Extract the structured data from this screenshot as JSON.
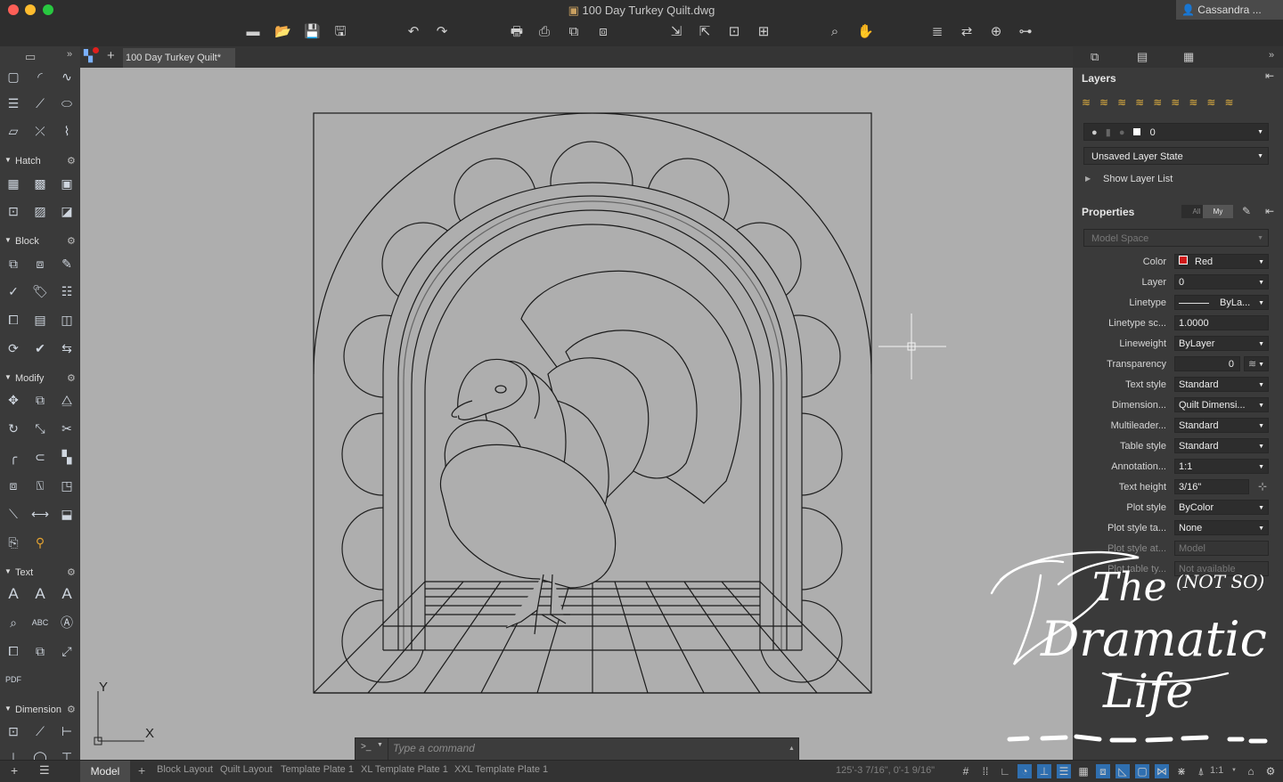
{
  "window": {
    "title": "100 Day Turkey Quilt.dwg",
    "user": "Cassandra ..."
  },
  "tabs": {
    "document": "100 Day Turkey Quilt*"
  },
  "left_panel": {
    "sections": [
      "Hatch",
      "Block",
      "Modify",
      "Text",
      "Dimension"
    ]
  },
  "canvas": {
    "ucs_x": "X",
    "ucs_y": "Y"
  },
  "command": {
    "prompt": ">_",
    "placeholder": "Type a command"
  },
  "layers": {
    "title": "Layers",
    "current_layer": "0",
    "layer_state": "Unsaved Layer State",
    "show_list": "Show Layer List"
  },
  "properties": {
    "title": "Properties",
    "filter_all": "All",
    "filter_my": "My",
    "space": "Model Space",
    "rows": [
      {
        "label": "Color",
        "value": "Red"
      },
      {
        "label": "Layer",
        "value": "0"
      },
      {
        "label": "Linetype",
        "value": "ByLa..."
      },
      {
        "label": "Linetype sc...",
        "value": "1.0000"
      },
      {
        "label": "Lineweight",
        "value": "ByLayer"
      },
      {
        "label": "Transparency",
        "value": "0"
      },
      {
        "label": "Text style",
        "value": "Standard"
      },
      {
        "label": "Dimension...",
        "value": "Quilt Dimensi..."
      },
      {
        "label": "Multileader...",
        "value": "Standard"
      },
      {
        "label": "Table style",
        "value": "Standard"
      },
      {
        "label": "Annotation...",
        "value": "1:1"
      },
      {
        "label": "Text height",
        "value": "3/16\""
      },
      {
        "label": "Plot style",
        "value": "ByColor"
      },
      {
        "label": "Plot style ta...",
        "value": "None"
      },
      {
        "label": "Plot style at...",
        "value": "Model"
      },
      {
        "label": "Plot table ty...",
        "value": "Not available"
      }
    ]
  },
  "layout_tabs": [
    "Model",
    "Block Layout",
    "Quilt Layout",
    "Template Plate 1",
    "XL Template Plate 1",
    "XXL Template Plate 1"
  ],
  "status": {
    "coordinates": "125'-3 7/16\", 0'-1 9/16\"",
    "scale": "1:1"
  },
  "watermark": {
    "line1": "The",
    "line2": "(NOT SO)",
    "line3": "Dramatic",
    "line4": "Life"
  },
  "colors": {
    "red_swatch": "#d11a1a",
    "canvas_bg": "#aeaeae",
    "panel_bg": "#3a3a3a"
  }
}
